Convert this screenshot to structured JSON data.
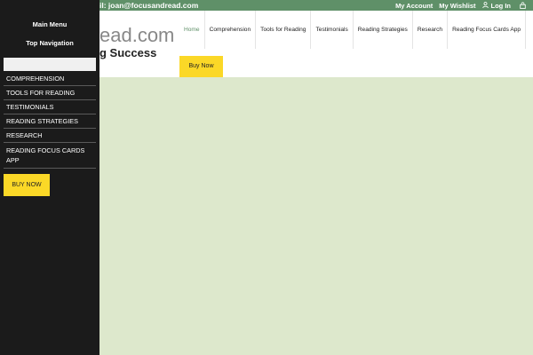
{
  "topbar": {
    "email_text": "il: joan@focusandread.com",
    "my_account": "My Account",
    "my_wishlist": "My Wishlist",
    "login": "Log In",
    "bg_color": "#5f9068"
  },
  "header": {
    "logo_text": "ead.com",
    "tagline": "g Success",
    "buy_label": "Buy Now"
  },
  "nav": {
    "items": [
      {
        "label": "Home",
        "active": true
      },
      {
        "label": "Comprehension"
      },
      {
        "label": "Tools for Reading"
      },
      {
        "label": "Testimonials"
      },
      {
        "label": "Reading Strategies"
      },
      {
        "label": "Research"
      },
      {
        "label": "Reading Focus Cards App"
      }
    ]
  },
  "sidebar": {
    "main_menu_title": "Main Menu",
    "top_nav_title": "Top Navigation",
    "search_value": "",
    "items": [
      {
        "label": "COMPREHENSION"
      },
      {
        "label": "TOOLS FOR READING"
      },
      {
        "label": "TESTIMONIALS"
      },
      {
        "label": "READING STRATEGIES"
      },
      {
        "label": "RESEARCH"
      },
      {
        "label": "READING FOCUS CARDS APP"
      }
    ],
    "buy_label": "BUY NOW"
  },
  "colors": {
    "accent_yellow": "#fbd827",
    "content_bg": "#dde8cc",
    "sidebar_bg": "#1b1b1b"
  },
  "icons": {
    "login": "user-icon",
    "cart": "lock-icon"
  }
}
